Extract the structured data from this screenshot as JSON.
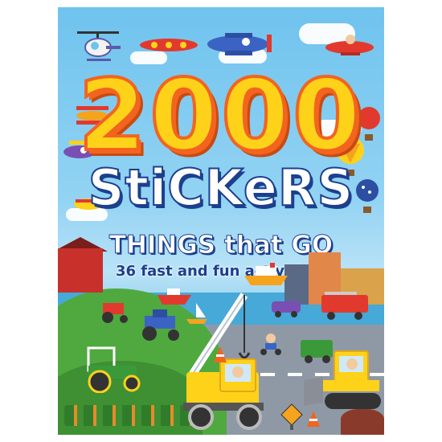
{
  "cover": {
    "number": "2000",
    "headline": "StiCKeRS",
    "title": "THINGS that GO",
    "subtitle": "36 fast and fun activities!"
  },
  "colors": {
    "sky": "#6fc3ee",
    "number_fill": "#ffd21a",
    "number_outline": "#f3641f",
    "headline_outline": "#1c3f8f"
  },
  "icons": [
    "helicopter-icon",
    "plane-icon",
    "hot-air-balloon-icon",
    "boat-icon",
    "tractor-icon",
    "crane-truck-icon",
    "bulldozer-icon",
    "traffic-cone-icon"
  ]
}
